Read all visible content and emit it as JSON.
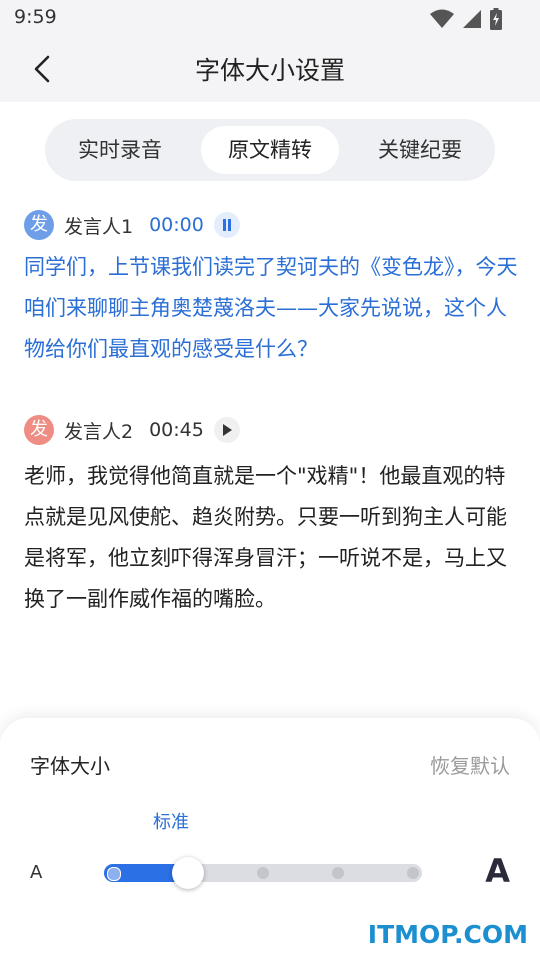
{
  "status_bar": {
    "time": "9:59",
    "icons": [
      "wifi-icon",
      "signal-icon",
      "battery-icon"
    ]
  },
  "header": {
    "title": "字体大小设置",
    "back_icon": "chevron-left-icon"
  },
  "tabs": [
    {
      "label": "实时录音",
      "active": false
    },
    {
      "label": "原文精转",
      "active": true
    },
    {
      "label": "关键纪要",
      "active": false
    }
  ],
  "transcript": [
    {
      "avatar": "发",
      "speaker": "发言人1",
      "time": "00:00",
      "state": "pause",
      "text": "同学们，上节课我们读完了契诃夫的《变色龙》，今天咱们来聊聊主角奥楚蔑洛夫——大家先说说，这个人物给你们最直观的感受是什么？",
      "color": "#2b6fd6"
    },
    {
      "avatar": "发",
      "speaker": "发言人2",
      "time": "00:45",
      "state": "play",
      "text": "老师，我觉得他简直就是一个\"戏精\"！他最直观的特点就是见风使舵、趋炎附势。只要一听到狗主人可能是将军，他立刻吓得浑身冒汗；一听说不是，马上又换了一副作威作福的嘴脸。",
      "color": "#222222"
    }
  ],
  "font_panel": {
    "title": "字体大小",
    "reset": "恢复默认",
    "current_level": "标准",
    "small_label": "A",
    "large_label": "A",
    "step_count": 5,
    "selected_step": 2
  },
  "colors": {
    "accent": "#2b70e4",
    "accent_text": "#2b6fd6"
  },
  "watermark": "ITMOP.COM"
}
